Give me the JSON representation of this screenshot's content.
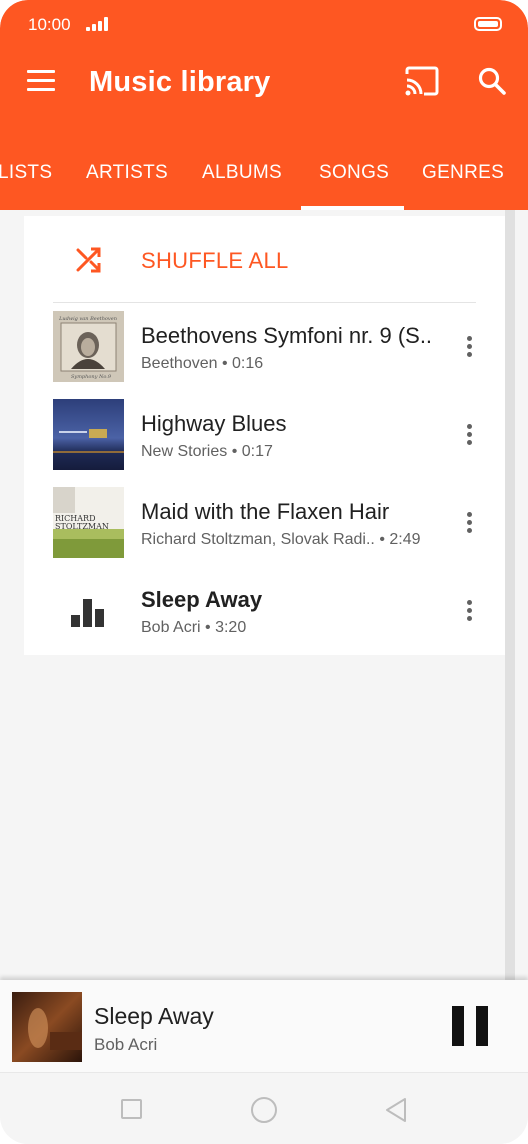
{
  "status_bar": {
    "time": "10:00"
  },
  "app_bar": {
    "title": "Music library"
  },
  "tabs": [
    {
      "label": "LISTS"
    },
    {
      "label": "ARTISTS"
    },
    {
      "label": "ALBUMS"
    },
    {
      "label": "SONGS",
      "selected": true
    },
    {
      "label": "GENRES"
    }
  ],
  "shuffle": {
    "label": "SHUFFLE ALL"
  },
  "songs": [
    {
      "title": "Beethovens Symfoni nr. 9 (S..",
      "subtitle": "Beethoven • 0:16"
    },
    {
      "title": "Highway Blues",
      "subtitle": "New Stories • 0:17"
    },
    {
      "title": "Maid with the Flaxen Hair",
      "subtitle": "Richard Stoltzman, Slovak Radi..  • 2:49"
    },
    {
      "title": "Sleep Away",
      "subtitle": "Bob Acri • 3:20",
      "playing": true
    }
  ],
  "now_playing": {
    "title": "Sleep Away",
    "artist": "Bob Acri"
  },
  "colors": {
    "accent": "#fe5722",
    "text_primary": "#212121",
    "text_secondary": "#616161"
  },
  "icons": [
    "menu-icon",
    "cast-icon",
    "search-icon",
    "shuffle-icon",
    "more-vert-icon",
    "equalizer-icon",
    "pause-icon",
    "nav-recents-icon",
    "nav-home-icon",
    "nav-back-icon"
  ]
}
